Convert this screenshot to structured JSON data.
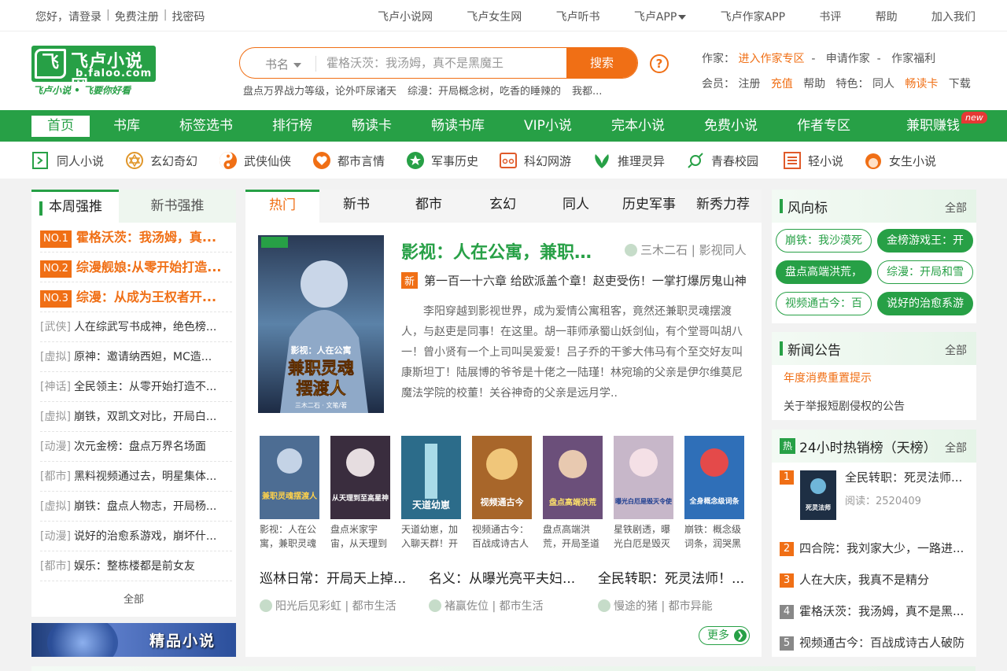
{
  "topbar": {
    "left": [
      "您好，请登录",
      "免费注册",
      "找密码"
    ],
    "right": [
      "飞卢小说网",
      "飞卢女生网",
      "飞卢听书",
      "飞卢APP",
      "飞卢作家APP",
      "书评",
      "帮助",
      "加入我们"
    ]
  },
  "logo": {
    "title": "飞卢小说网",
    "url": "b.faloo.com",
    "slogan": "飞卢小说 • 飞要你好看",
    "mark": "飞"
  },
  "search": {
    "type_label": "书名",
    "placeholder": "霍格沃茨：我汤姆，真不是黑魔王",
    "button": "搜索",
    "hot_words": [
      "盘点万界战力等级，论外吓尿诸天",
      "综漫：开局概念树，吃香的睡辣的",
      "我都..."
    ]
  },
  "author_links": {
    "label": "作家：",
    "zone": "进入作家专区",
    "apply": "申请作家",
    "welfare": "作家福利"
  },
  "member_links": {
    "label": "会员：",
    "register": "注册",
    "recharge": "充值",
    "help": "帮助",
    "feature_label": "特色：",
    "tongren": "同人",
    "card": "畅读卡",
    "download": "下载"
  },
  "nav": {
    "items": [
      "首页",
      "书库",
      "标签选书",
      "排行榜",
      "畅读卡",
      "畅读书库",
      "VIP小说",
      "完本小说",
      "免费小说",
      "作者专区",
      "兼职赚钱"
    ],
    "badge": "new"
  },
  "categories": [
    "同人小说",
    "玄幻奇幻",
    "武侠仙侠",
    "都市言情",
    "军事历史",
    "科幻网游",
    "推理灵异",
    "青春校园",
    "轻小说",
    "女生小说"
  ],
  "left_panel": {
    "tabs": [
      "本周强推",
      "新书强推"
    ],
    "top": [
      {
        "no": "NO.1",
        "title": "霍格沃茨：我汤姆，真..."
      },
      {
        "no": "NO.2",
        "title": "综漫舰娘:从零开始打造..."
      },
      {
        "no": "NO.3",
        "title": "综漫：从成为王权者开..."
      }
    ],
    "list": [
      {
        "tag": "[武侠]",
        "title": "人在综武写书成神，绝色榜..."
      },
      {
        "tag": "[虚拟]",
        "title": "原神：邀请纳西妲，MC造..."
      },
      {
        "tag": "[神话]",
        "title": "全民领主：从零开始打造不..."
      },
      {
        "tag": "[虚拟]",
        "title": "崩铁，双凯文对比，开局白..."
      },
      {
        "tag": "[动漫]",
        "title": "次元金榜：盘点万界名场面"
      },
      {
        "tag": "[都市]",
        "title": "黑料视频通过去，明星集体..."
      },
      {
        "tag": "[虚拟]",
        "title": "崩铁：盘点人物志，开局杨..."
      },
      {
        "tag": "[动漫]",
        "title": "说好的治愈系游戏，崩坏什..."
      },
      {
        "tag": "[都市]",
        "title": "娱乐：整栋楼都是前女友"
      }
    ],
    "all": "全部",
    "banner": "精品小说"
  },
  "center_panel": {
    "tabs": [
      "热门",
      "新书",
      "都市",
      "玄幻",
      "同人",
      "历史军事",
      "新秀力荐"
    ],
    "featured": {
      "title": "影视：人在公寓，兼职灵...",
      "author": "三木二石 | 影视同人",
      "new_label": "新",
      "chapter": "第一百一十六章 给欧派盖个章！赵吏受伤！一掌打爆厉鬼山神",
      "desc": "李阳穿越到影视世界，成为爱情公寓租客，竟然还兼职灵魂摆渡人，与赵吏是同事！在这里。胡一菲师承蜀山妖剑仙，有个堂哥叫胡八一！曾小贤有一个上司叫吴爱爱！吕子乔的干爹大伟马有个至交好友叫康斯坦丁！陆展博的爷爷是十佬之一陆瑾！林宛瑜的父亲是伊尔维莫尼魔法学院的校董！关谷神奇的父亲是远月学..",
      "cover_text": "影视：人在公寓 兼职灵魂 摆渡人",
      "cover_author": "三木二石 · 文笔/著"
    },
    "books": [
      {
        "name": "影视：人在公寓，兼职灵魂",
        "cover": "兼职灵魂摆渡人"
      },
      {
        "name": "盘点米家宇宙，从天理到",
        "cover": "从天理到至高星神"
      },
      {
        "name": "天道幼崽，加入聊天群！开",
        "cover": "天道幼崽"
      },
      {
        "name": "视频通古今：百战成诗古人",
        "cover": "视频通古今"
      },
      {
        "name": "盘点高端洪荒，开局圣道",
        "cover": "盘点高端洪荒"
      },
      {
        "name": "星铁剧透，曝光白厄是毁灭",
        "cover": "曝光白厄是毁灭令使"
      },
      {
        "name": "崩铁：概念级词条，润哭黑",
        "cover": "全身概念级词条"
      }
    ],
    "recs": [
      {
        "title": "巡林日常：开局天上掉...",
        "author": "阳光后见彩虹 | 都市生活"
      },
      {
        "title": "名义：从曝光亮平夫妇...",
        "author": "褚赢佐位 | 都市生活"
      },
      {
        "title": "全民转职：死灵法师！...",
        "author": "慢途的猪 | 都市异能"
      }
    ],
    "more": "更多"
  },
  "trend": {
    "title": "风向标",
    "all": "全部",
    "pills": [
      "崩铁：我沙漠死",
      "金榜游戏王：开",
      "盘点高端洪荒，",
      "综漫：开局和雪",
      "视频通古今：百",
      "说好的治愈系游"
    ]
  },
  "news": {
    "title": "新闻公告",
    "all": "全部",
    "items": [
      "年度消费重置提示",
      "关于举报短剧侵权的公告"
    ]
  },
  "hot24": {
    "hot_icon": "热",
    "title": "24小时热销榜（天榜）",
    "all": "全部",
    "first": {
      "num": "1",
      "title": "全民转职：死灵法师...",
      "reads": "阅读：2520409"
    },
    "items": [
      {
        "num": "2",
        "title": "四合院：我刘家大少，一路进..."
      },
      {
        "num": "3",
        "title": "人在大庆，我真不是精分"
      },
      {
        "num": "4",
        "title": "霍格沃茨：我汤姆，真不是黑..."
      },
      {
        "num": "5",
        "title": "视频通古今：百战成诗古人破防"
      }
    ]
  },
  "colors": {
    "green": "#27a046",
    "orange": "#f06f15"
  }
}
